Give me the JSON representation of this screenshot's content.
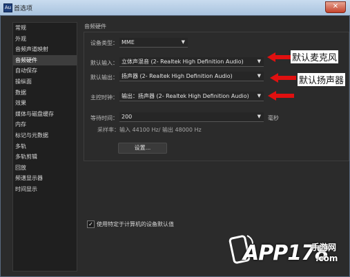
{
  "window": {
    "title": "首选项",
    "close_label": "✕"
  },
  "sidebar": {
    "items": [
      {
        "label": "常规"
      },
      {
        "label": "外观"
      },
      {
        "label": "音频声道映射"
      },
      {
        "label": "音频硬件"
      },
      {
        "label": "自动保存"
      },
      {
        "label": "操纵面"
      },
      {
        "label": "数据"
      },
      {
        "label": "效果"
      },
      {
        "label": "媒体与磁盘缓存"
      },
      {
        "label": "内存"
      },
      {
        "label": "标记与元数据"
      },
      {
        "label": "多轨"
      },
      {
        "label": "多轨剪辑"
      },
      {
        "label": "回放"
      },
      {
        "label": "频谱显示器"
      },
      {
        "label": "时间显示"
      }
    ],
    "active_index": 3
  },
  "section_title": "音频硬件",
  "device_class": {
    "label": "设备类型：",
    "value": "MME"
  },
  "default_input": {
    "label": "默认输入：",
    "value": "立体声混音 (2- Realtek High Definition Audio)"
  },
  "default_output": {
    "label": "默认输出：",
    "value": "扬声器 (2- Realtek High Definition Audio)"
  },
  "master_clock": {
    "label": "主控时钟：",
    "value": "输出：扬声器 (2- Realtek High Definition Audio)"
  },
  "latency": {
    "label": "等待时间：",
    "value": "200",
    "unit": "毫秒"
  },
  "sample_rate_text": "采样率：输入 44100 Hz/ 输出 48000 Hz",
  "settings_button": "设置...",
  "use_default_checkbox": {
    "label": "使用特定于计算机的设备默认值",
    "checked": true
  },
  "annotations": {
    "mic": "默认麦克风",
    "speaker": "默认扬声器",
    "arrow_color": "#e01010"
  },
  "watermark": {
    "brand": "APP178",
    "sub": "手游网",
    "domain": ".com"
  },
  "icons": {
    "caret": "▼",
    "check": "✓"
  }
}
